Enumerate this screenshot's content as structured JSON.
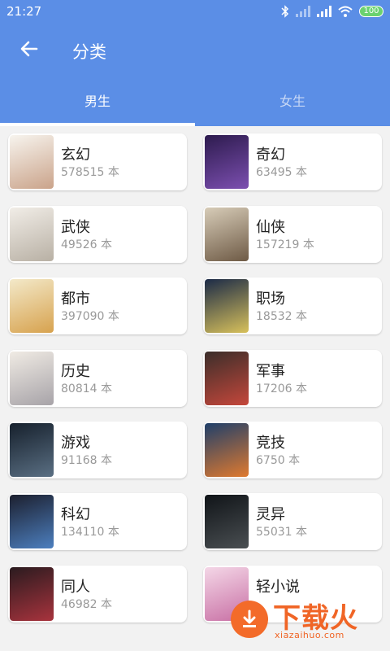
{
  "status": {
    "time": "21:27",
    "battery": "100"
  },
  "header": {
    "title": "分类",
    "back_icon": "arrow-left-icon"
  },
  "tabs": [
    {
      "label": "男生",
      "active": true
    },
    {
      "label": "女生",
      "active": false
    }
  ],
  "categories": [
    {
      "name": "玄幻",
      "count": "578515 本",
      "cover": "玄幻 cover",
      "cover_colors": [
        "#f7f4ee",
        "#caa38a"
      ]
    },
    {
      "name": "奇幻",
      "count": "63495 本",
      "cover": "奇幻 cover",
      "cover_colors": [
        "#2d1b4e",
        "#7c4fb0"
      ]
    },
    {
      "name": "武侠",
      "count": "49526 本",
      "cover": "武侠 cover",
      "cover_colors": [
        "#f1ede7",
        "#b8b0a4"
      ]
    },
    {
      "name": "仙侠",
      "count": "157219 本",
      "cover": "仙侠 cover",
      "cover_colors": [
        "#d7ccb8",
        "#6e5a45"
      ]
    },
    {
      "name": "都市",
      "count": "397090 本",
      "cover": "都市 cover",
      "cover_colors": [
        "#f3e9c9",
        "#d7a24e"
      ]
    },
    {
      "name": "职场",
      "count": "18532 本",
      "cover": "职场 cover",
      "cover_colors": [
        "#1b2a47",
        "#d8c15b"
      ]
    },
    {
      "name": "历史",
      "count": "80814 本",
      "cover": "历史 cover",
      "cover_colors": [
        "#f0ebe4",
        "#a7a3a8"
      ]
    },
    {
      "name": "军事",
      "count": "17206 本",
      "cover": "军事 cover",
      "cover_colors": [
        "#3b2e2a",
        "#c5473b"
      ]
    },
    {
      "name": "游戏",
      "count": "91168 本",
      "cover": "游戏 cover",
      "cover_colors": [
        "#16202c",
        "#5a6f83"
      ]
    },
    {
      "name": "竞技",
      "count": "6750 本",
      "cover": "竞技 cover",
      "cover_colors": [
        "#1f3f6a",
        "#e07a2f"
      ]
    },
    {
      "name": "科幻",
      "count": "134110 本",
      "cover": "科幻 cover",
      "cover_colors": [
        "#1c1f2e",
        "#4c7fbf"
      ]
    },
    {
      "name": "灵异",
      "count": "55031 本",
      "cover": "灵异 cover",
      "cover_colors": [
        "#101418",
        "#4a4f52"
      ]
    },
    {
      "name": "同人",
      "count": "46982 本",
      "cover": "同人 cover",
      "cover_colors": [
        "#2a1b1f",
        "#a8333d"
      ]
    },
    {
      "name": "轻小说",
      "count": "",
      "cover": "轻小说 cover",
      "cover_colors": [
        "#f4d7e7",
        "#c86fa4"
      ]
    }
  ],
  "watermark": {
    "title": "下载火",
    "url": "xiazaihuo.com"
  },
  "colors": {
    "primary": "#5b8ee6",
    "background": "#f2f2f2",
    "card": "#ffffff",
    "watermark": "#f06526"
  }
}
